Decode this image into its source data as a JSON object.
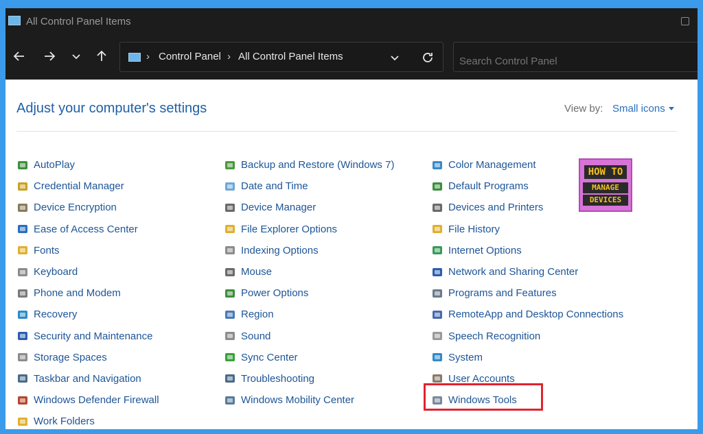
{
  "window": {
    "title": "All Control Panel Items"
  },
  "address": {
    "crumbs": [
      "Control Panel",
      "All Control Panel Items"
    ],
    "search_placeholder": "Search Control Panel"
  },
  "header": {
    "title": "Adjust your computer's settings",
    "view_by_label": "View by:",
    "view_by_value": "Small icons"
  },
  "logo": {
    "line1": "HOW TO",
    "line2": "MANAGE",
    "line3": "DEVICES"
  },
  "columns": [
    [
      {
        "label": "AutoPlay",
        "icon": "autoplay-icon",
        "color": "#3d8f3d"
      },
      {
        "label": "Credential Manager",
        "icon": "credential-manager-icon",
        "color": "#c9a227"
      },
      {
        "label": "Device Encryption",
        "icon": "device-encryption-icon",
        "color": "#8a7a5a"
      },
      {
        "label": "Ease of Access Center",
        "icon": "ease-of-access-icon",
        "color": "#2a6ebb"
      },
      {
        "label": "Fonts",
        "icon": "fonts-icon",
        "color": "#e0b030"
      },
      {
        "label": "Keyboard",
        "icon": "keyboard-icon",
        "color": "#8c8c8c"
      },
      {
        "label": "Phone and Modem",
        "icon": "phone-modem-icon",
        "color": "#7a7a7a"
      },
      {
        "label": "Recovery",
        "icon": "recovery-icon",
        "color": "#2e8bc9"
      },
      {
        "label": "Security and Maintenance",
        "icon": "security-maintenance-icon",
        "color": "#2a5db0"
      },
      {
        "label": "Storage Spaces",
        "icon": "storage-spaces-icon",
        "color": "#8c8c8c"
      },
      {
        "label": "Taskbar and Navigation",
        "icon": "taskbar-navigation-icon",
        "color": "#4a6a8a"
      },
      {
        "label": "Windows Defender Firewall",
        "icon": "firewall-icon",
        "color": "#b5472f"
      },
      {
        "label": "Work Folders",
        "icon": "work-folders-icon",
        "color": "#e0b030"
      }
    ],
    [
      {
        "label": "Backup and Restore (Windows 7)",
        "icon": "backup-restore-icon",
        "color": "#4a9a3a"
      },
      {
        "label": "Date and Time",
        "icon": "date-time-icon",
        "color": "#6fa8d8"
      },
      {
        "label": "Device Manager",
        "icon": "device-manager-icon",
        "color": "#6a6a6a"
      },
      {
        "label": "File Explorer Options",
        "icon": "file-explorer-options-icon",
        "color": "#e0b030"
      },
      {
        "label": "Indexing Options",
        "icon": "indexing-options-icon",
        "color": "#8c8c8c"
      },
      {
        "label": "Mouse",
        "icon": "mouse-icon",
        "color": "#6a6a6a"
      },
      {
        "label": "Power Options",
        "icon": "power-options-icon",
        "color": "#3d8f3d"
      },
      {
        "label": "Region",
        "icon": "region-icon",
        "color": "#4a7ab8"
      },
      {
        "label": "Sound",
        "icon": "sound-icon",
        "color": "#8c8c8c"
      },
      {
        "label": "Sync Center",
        "icon": "sync-center-icon",
        "color": "#3aa03a"
      },
      {
        "label": "Troubleshooting",
        "icon": "troubleshooting-icon",
        "color": "#4a6a8a"
      },
      {
        "label": "Windows Mobility Center",
        "icon": "mobility-center-icon",
        "color": "#5a7a9a"
      }
    ],
    [
      {
        "label": "Color Management",
        "icon": "color-management-icon",
        "color": "#3a8ac9"
      },
      {
        "label": "Default Programs",
        "icon": "default-programs-icon",
        "color": "#3d8f3d"
      },
      {
        "label": "Devices and Printers",
        "icon": "devices-printers-icon",
        "color": "#6a6a6a"
      },
      {
        "label": "File History",
        "icon": "file-history-icon",
        "color": "#e0b030"
      },
      {
        "label": "Internet Options",
        "icon": "internet-options-icon",
        "color": "#3a9a5a"
      },
      {
        "label": "Network and Sharing Center",
        "icon": "network-sharing-icon",
        "color": "#2a5db0"
      },
      {
        "label": "Programs and Features",
        "icon": "programs-features-icon",
        "color": "#6a7a8a"
      },
      {
        "label": "RemoteApp and Desktop Connections",
        "icon": "remoteapp-icon",
        "color": "#4a6ab0"
      },
      {
        "label": "Speech Recognition",
        "icon": "speech-recognition-icon",
        "color": "#9a9a9a"
      },
      {
        "label": "System",
        "icon": "system-icon",
        "color": "#2e8bc9"
      },
      {
        "label": "User Accounts",
        "icon": "user-accounts-icon",
        "color": "#8a7a6a"
      },
      {
        "label": "Windows Tools",
        "icon": "windows-tools-icon",
        "color": "#7a8a9a"
      }
    ]
  ],
  "colors": {
    "link": "#1d5597",
    "heading": "#1f5fa7",
    "highlight": "#e0232e",
    "frame": "#3b9bea"
  }
}
